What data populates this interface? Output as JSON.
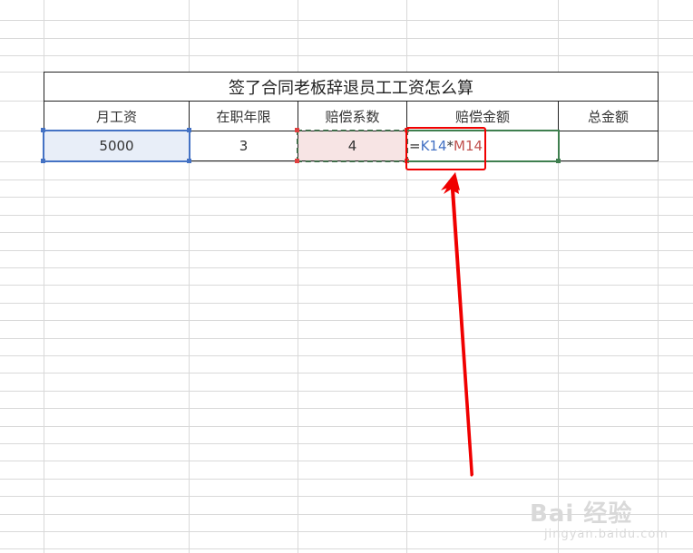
{
  "table": {
    "title": "签了合同老板辞退员工工资怎么算",
    "headers": [
      "月工资",
      "在职年限",
      "赔偿系数",
      "赔偿金额",
      "总金额"
    ],
    "row": {
      "salary": "5000",
      "years": "3",
      "coefficient": "4",
      "formula": {
        "eq": "=",
        "ref1": "K14",
        "op": "*",
        "ref2": "M14"
      },
      "total": ""
    }
  },
  "colors": {
    "ref1_color": "#4472c4",
    "ref2_color": "#c0504d",
    "highlight_box": "#f00000",
    "arrow": "#f00000"
  },
  "watermark": {
    "logo": "Bai 经验",
    "url": "jingyan.baidu.com"
  }
}
